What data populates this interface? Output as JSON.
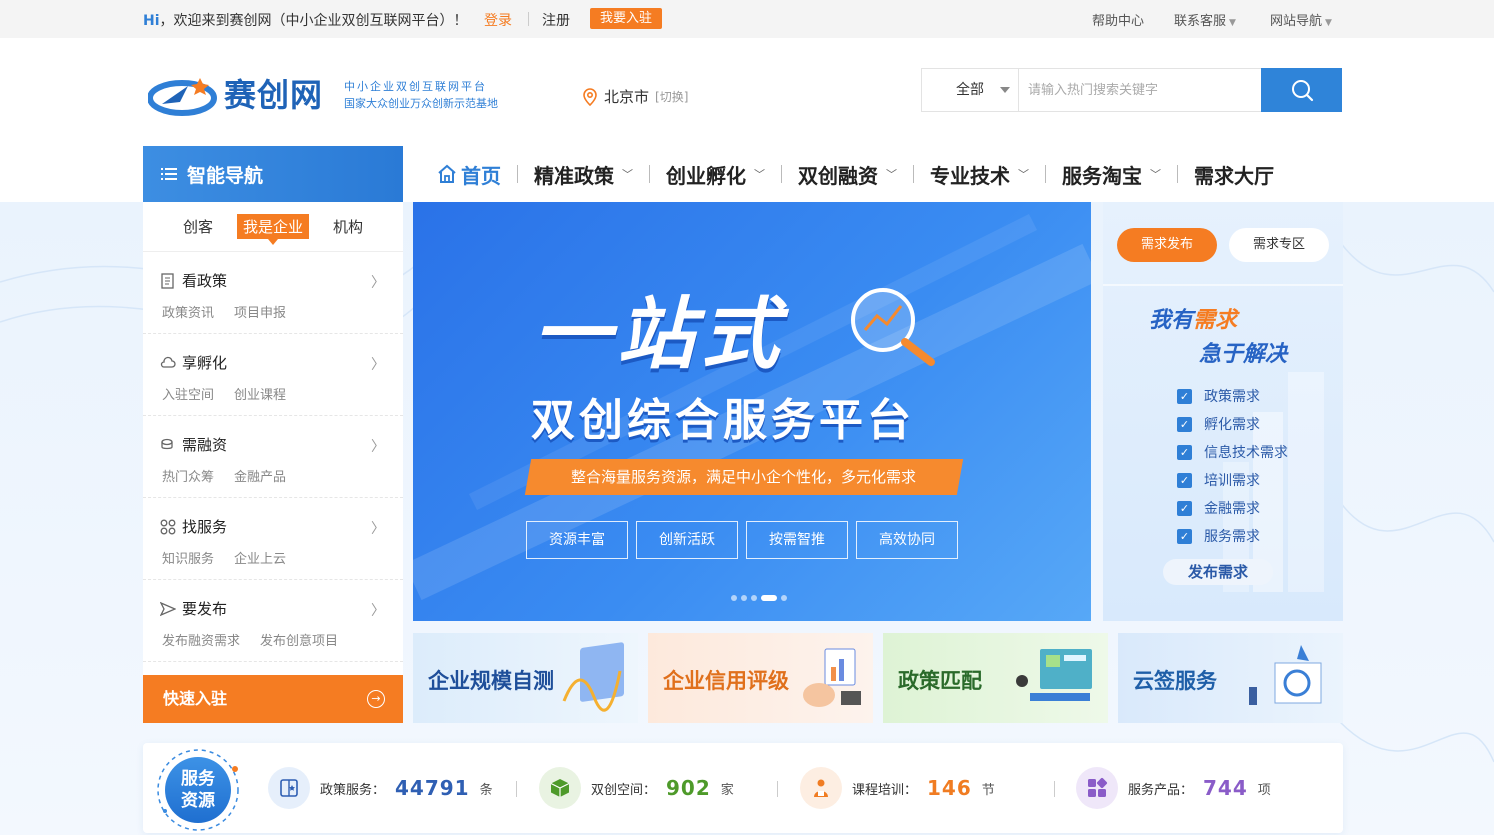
{
  "topbar": {
    "hi": "Hi",
    "welcome": "，欢迎来到赛创网（中小企业双创互联网平台）！",
    "login": "登录",
    "register": "注册",
    "join": "我要入驻",
    "help": "帮助中心",
    "service": "联系客服",
    "sitenav": "网站导航"
  },
  "logo": {
    "name": "赛创网",
    "slogan1": "中小企业双创互联网平台",
    "slogan2": "国家大众创业万众创新示范基地"
  },
  "location": {
    "city": "北京市",
    "switch": "[切换]"
  },
  "search": {
    "category": "全部",
    "placeholder": "请输入热门搜索关键字"
  },
  "smartnav": {
    "title": "智能导航"
  },
  "nav": {
    "home": "首页",
    "items": [
      "精准政策",
      "创业孵化",
      "双创融资",
      "专业技术",
      "服务淘宝",
      "需求大厅"
    ]
  },
  "sidebar": {
    "tabs": [
      "创客",
      "我是企业",
      "机构"
    ],
    "active_tab": "我是企业",
    "groups": [
      {
        "title": "看政策",
        "links": [
          "政策资讯",
          "项目申报"
        ]
      },
      {
        "title": "享孵化",
        "links": [
          "入驻空间",
          "创业课程"
        ]
      },
      {
        "title": "需融资",
        "links": [
          "热门众筹",
          "金融产品"
        ]
      },
      {
        "title": "找服务",
        "links": [
          "知识服务",
          "企业上云"
        ]
      },
      {
        "title": "要发布",
        "links": [
          "发布融资需求",
          "发布创意项目"
        ]
      }
    ],
    "quick": "快速入驻"
  },
  "banner": {
    "title": "一站式",
    "subtitle": "双创综合服务平台",
    "strip": "整合海量服务资源，满足中小企个性化，多元化需求",
    "tags": [
      "资源丰富",
      "创新活跃",
      "按需智推",
      "高效协同"
    ],
    "slide_index": 4,
    "slide_total": 5
  },
  "need": {
    "tab_publish": "需求发布",
    "tab_zone": "需求专区",
    "headline_a": "我有",
    "headline_b": "需求",
    "headline2": "急于解决",
    "list": [
      "政策需求",
      "孵化需求",
      "信息技术需求",
      "培训需求",
      "金融需求",
      "服务需求"
    ],
    "publish": "发布需求"
  },
  "cards": [
    {
      "label": "企业规模自测",
      "color": "#1f4f9a"
    },
    {
      "label": "企业信用评级",
      "color": "#e0701c"
    },
    {
      "label": "政策匹配",
      "color": "#2a6a2a"
    },
    {
      "label": "云签服务",
      "color": "#1f5fa8"
    }
  ],
  "stats": {
    "badge_line1": "服务",
    "badge_line2": "资源",
    "items": [
      {
        "label": "政策服务：",
        "value": "44791",
        "unit": "条",
        "color": "#2f5fb3"
      },
      {
        "label": "双创空间：",
        "value": "902",
        "unit": "家",
        "color": "#4e9a2a"
      },
      {
        "label": "课程培训：",
        "value": "146",
        "unit": "节",
        "color": "#f07c22"
      },
      {
        "label": "服务产品：",
        "value": "744",
        "unit": "项",
        "color": "#8a5cc8"
      }
    ]
  },
  "colors": {
    "brand": "#2f7fd6",
    "accent": "#f57c22"
  }
}
